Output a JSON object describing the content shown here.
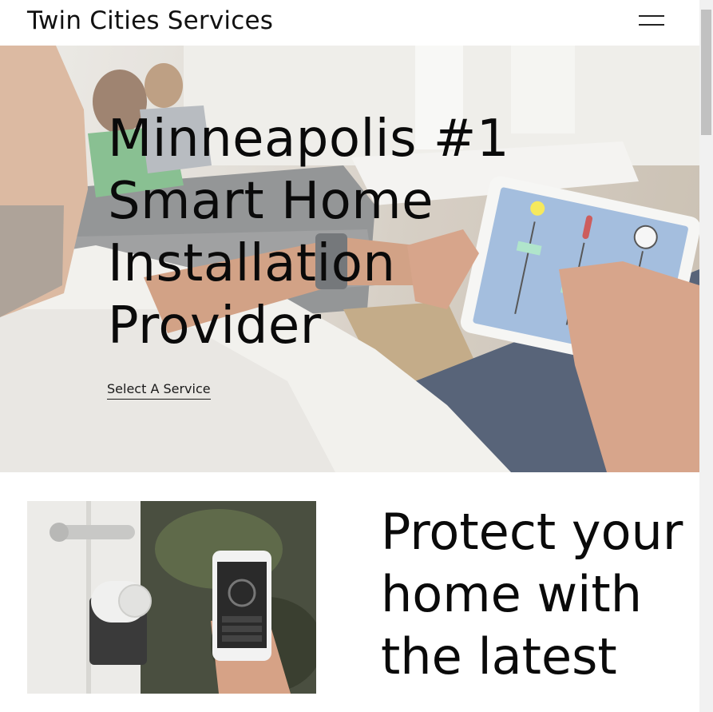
{
  "header": {
    "site_title": "Twin Cities Services"
  },
  "hero": {
    "title": "Minneapolis #1 Smart Home Installation Provider",
    "link_label": "Select A Service"
  },
  "feature": {
    "heading": "Protect your home with the latest"
  },
  "icons": {
    "menu": "hamburger-menu-icon"
  }
}
